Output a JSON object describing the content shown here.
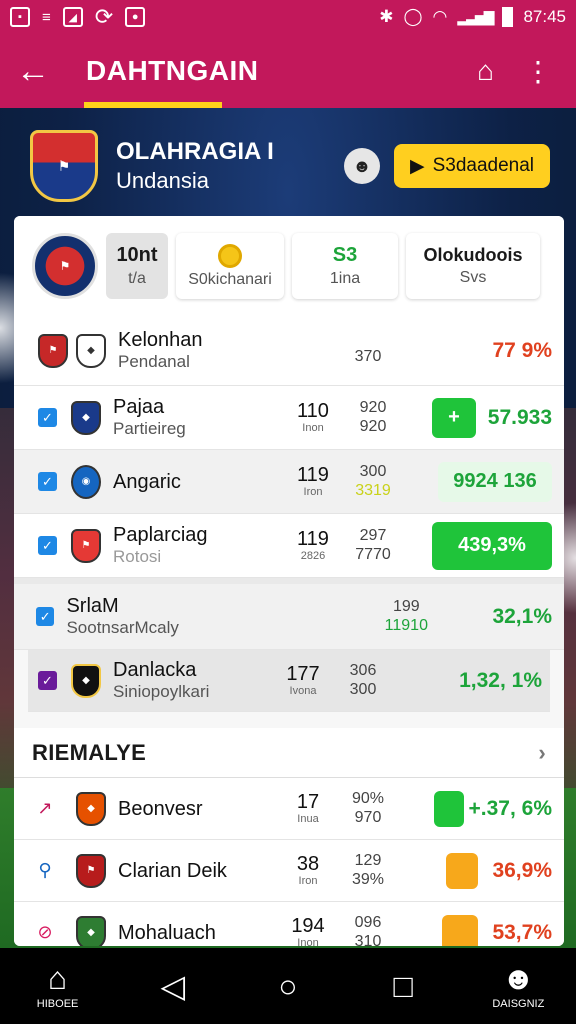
{
  "statusbar": {
    "time": "87:45",
    "left_icons": [
      "sim-icon",
      "notification-icon",
      "sync-icon",
      "app-icon"
    ],
    "right_icons": [
      "bluetooth-icon",
      "alarm-icon",
      "wifi-icon",
      "signal-icon",
      "battery-icon"
    ]
  },
  "appbar": {
    "title": "DAHTNGAIN",
    "back_icon": "arrow-left-icon",
    "actions": [
      "home-icon",
      "more-vert-icon"
    ]
  },
  "team": {
    "name_line1": "OLAHRAGIA I",
    "name_line2": "Undansia",
    "cta_label": "S3daadenal"
  },
  "summary": {
    "box1": {
      "value": "10nt",
      "label": "t/a"
    },
    "box2": {
      "label": "S0kichanari"
    },
    "box3": {
      "value": "S3",
      "label": "1ina"
    },
    "box4": {
      "value": "Olokudoois",
      "label": "Svs"
    }
  },
  "rows": [
    {
      "name": "Kelonhan",
      "sub": "Pendanal",
      "num": "",
      "num_sub": "",
      "col": "370",
      "col2": "",
      "pct": "77 9%",
      "pct_color": "red",
      "pill": ""
    },
    {
      "name": "Pajaa",
      "sub": "Partieireg",
      "num": "110",
      "num_sub": "Inon",
      "col": "920",
      "col2": "920",
      "pct": "57.933",
      "pct_color": "green",
      "pill": "+"
    },
    {
      "name": "Angaric",
      "sub": "",
      "num": "119",
      "num_sub": "Iron",
      "col": "300",
      "col2": "3319",
      "pct": "9924 136",
      "pct_color": "green",
      "pill": ""
    },
    {
      "name": "Paplarciag",
      "sub": "Rotosi",
      "num": "119",
      "num_sub": "2826",
      "col": "297",
      "col2": "7770",
      "pct": "439,3%",
      "pct_color": "white",
      "pill": ""
    },
    {
      "name": "SrlaM",
      "sub": "SootnsarMcaly",
      "num": "",
      "num_sub": "",
      "col": "199",
      "col2": "11910",
      "pct": "32,1%",
      "pct_color": "green",
      "pill": ""
    },
    {
      "name": "Danlacka",
      "sub": "Siniopoylkari",
      "num": "177",
      "num_sub": "Ivona",
      "col": "306",
      "col2": "300",
      "pct": "1,32, 1%",
      "pct_color": "green",
      "pill": ""
    }
  ],
  "section": {
    "title": "RIEMALYE"
  },
  "rows2": [
    {
      "name": "Beonvesr",
      "num": "17",
      "num_sub": "Inua",
      "col": "90%",
      "col2": "970",
      "pct": "+.37, 6%",
      "pct_color": "green"
    },
    {
      "name": "Clarian Deik",
      "num": "38",
      "num_sub": "Iron",
      "col": "129",
      "col2": "39%",
      "pct": "36,9%",
      "pct_color": "red"
    },
    {
      "name": "Mohaluach",
      "num": "194",
      "num_sub": "Inon",
      "col": "096",
      "col2": "310",
      "pct": "53,7%",
      "pct_color": "red"
    }
  ],
  "navbar": {
    "home_label": "HIBOEE",
    "profile_label": "DAISGNIZ"
  }
}
